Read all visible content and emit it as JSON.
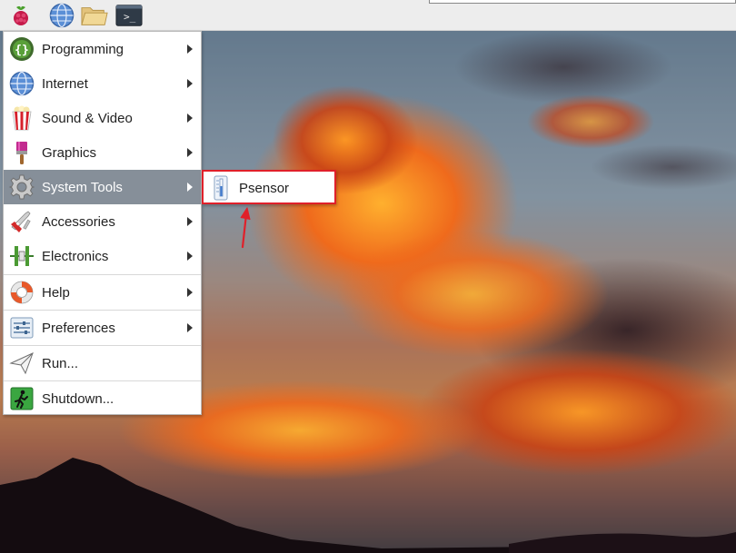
{
  "taskbar": {
    "launchers": [
      {
        "name": "raspberry-menu-icon"
      },
      {
        "name": "web-browser-icon"
      },
      {
        "name": "file-manager-icon"
      },
      {
        "name": "terminal-icon",
        "glyph": ">_"
      }
    ]
  },
  "menu": {
    "items": [
      {
        "label": "Programming",
        "icon": "programming-icon",
        "submenu": true
      },
      {
        "label": "Internet",
        "icon": "globe-icon",
        "submenu": true
      },
      {
        "label": "Sound & Video",
        "icon": "popcorn-icon",
        "submenu": true
      },
      {
        "label": "Graphics",
        "icon": "paintbrush-icon",
        "submenu": true
      },
      {
        "label": "System Tools",
        "icon": "gear-icon",
        "submenu": true,
        "active": true
      },
      {
        "label": "Accessories",
        "icon": "swiss-knife-icon",
        "submenu": true
      },
      {
        "label": "Electronics",
        "icon": "electronics-icon",
        "submenu": true
      },
      {
        "label": "Help",
        "icon": "lifebuoy-icon",
        "submenu": true
      },
      {
        "label": "Preferences",
        "icon": "sliders-icon",
        "submenu": true
      },
      {
        "label": "Run...",
        "icon": "paper-plane-icon",
        "submenu": false
      },
      {
        "label": "Shutdown...",
        "icon": "exit-icon",
        "submenu": false
      }
    ]
  },
  "submenu": {
    "items": [
      {
        "label": "Psensor",
        "icon": "thermometer-icon"
      }
    ]
  },
  "colors": {
    "active_item_bg": "#868f99",
    "highlight_border": "#e0202a",
    "panel_bg": "#ededed"
  }
}
